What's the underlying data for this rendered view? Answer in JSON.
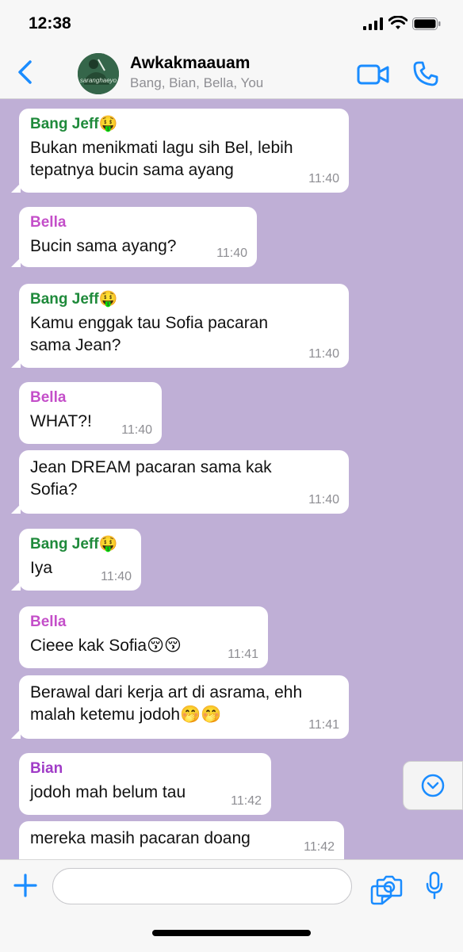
{
  "status": {
    "time": "12:38"
  },
  "header": {
    "title": "Awkakmaauam",
    "subtitle": "Bang, Bian, Bella, You",
    "avatar_text": "saranghaeyo"
  },
  "colors": {
    "accent": "#1a8cff",
    "chat_bg": "#bfafd6",
    "jeff": "#1f8a3b",
    "bella": "#c44fc9",
    "bian": "#a03cc7"
  },
  "messages": [
    {
      "sender": "Bang Jeff🤑",
      "sender_color": "#1f8a3b",
      "lines": [
        "Bukan menikmati lagu sih Bel, lebih",
        "tepatnya bucin sama ayang"
      ],
      "time": "11:40"
    },
    {
      "sender": "Bella",
      "sender_color": "#c44fc9",
      "lines": [
        "Bucin sama ayang?"
      ],
      "time": "11:40"
    },
    {
      "sender": "Bang Jeff🤑",
      "sender_color": "#1f8a3b",
      "lines": [
        "Kamu enggak tau Sofia pacaran",
        "sama Jean?"
      ],
      "time": "11:40"
    },
    {
      "sender": "Bella",
      "sender_color": "#c44fc9",
      "lines": [
        "WHAT?!"
      ],
      "time": "11:40"
    },
    {
      "sender": "",
      "lines": [
        "Jean DREAM pacaran sama kak",
        "Sofia?"
      ],
      "time": "11:40"
    },
    {
      "sender": "Bang Jeff🤑",
      "sender_color": "#1f8a3b",
      "lines": [
        "Iya"
      ],
      "time": "11:40"
    },
    {
      "sender": "Bella",
      "sender_color": "#c44fc9",
      "lines": [
        "Cieee kak Sofia😚😚"
      ],
      "time": "11:41"
    },
    {
      "sender": "",
      "lines": [
        "Berawal dari kerja art di asrama, ehh",
        "malah ketemu jodoh🤭🤭"
      ],
      "time": "11:41"
    },
    {
      "sender": "Bian",
      "sender_color": "#a03cc7",
      "lines": [
        "jodoh mah belum tau"
      ],
      "time": "11:42"
    },
    {
      "sender": "",
      "lines": [
        "mereka masih pacaran doang"
      ],
      "time": "11:42"
    }
  ]
}
